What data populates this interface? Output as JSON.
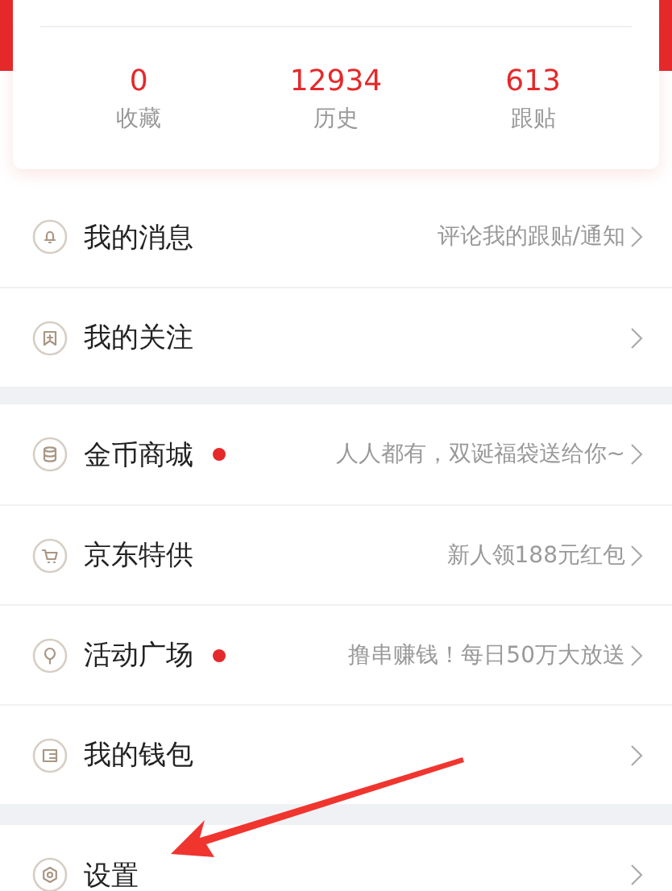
{
  "stats": [
    {
      "value": "0",
      "label": "收藏"
    },
    {
      "value": "12934",
      "label": "历史"
    },
    {
      "value": "613",
      "label": "跟贴"
    }
  ],
  "groups": [
    {
      "items": [
        {
          "title": "我的消息",
          "new": false,
          "subtitle": "评论我的跟贴/通知"
        },
        {
          "title": "我的关注",
          "new": false
        }
      ]
    },
    {
      "items": [
        {
          "title": "金币商城",
          "new": true,
          "subtitle": "人人都有，双诞福袋送给你~"
        },
        {
          "title": "京东特供",
          "new": false,
          "subtitle": "新人领188元红包"
        },
        {
          "title": "活动广场",
          "new": true,
          "subtitle": "撸串赚钱！每日50万大放送"
        },
        {
          "title": "我的钱包",
          "new": false
        }
      ]
    },
    {
      "items": [
        {
          "title": "设置",
          "new": false
        }
      ]
    }
  ]
}
